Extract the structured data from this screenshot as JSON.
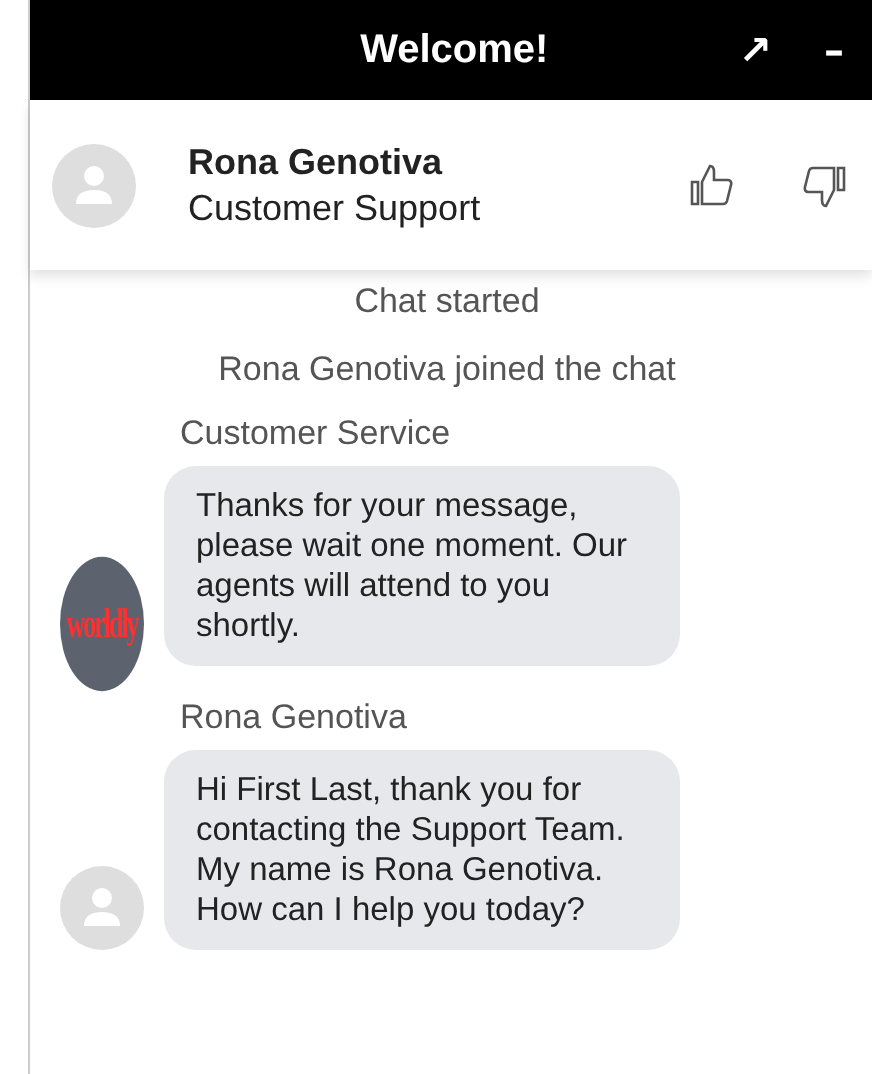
{
  "window": {
    "title": "Welcome!",
    "expand_icon": "↗",
    "minimize_icon": "–"
  },
  "agent": {
    "name": "Rona Genotiva",
    "role": "Customer Support"
  },
  "messages": [
    {
      "kind": "system",
      "text": "Chat started"
    },
    {
      "kind": "system",
      "text": "Rona Genotiva joined the chat"
    },
    {
      "kind": "message",
      "sender": "Customer Service",
      "avatar": {
        "kind": "logo",
        "text": "worldly"
      },
      "text": "Thanks for your message, please wait one moment. Our agents will attend to you shortly."
    },
    {
      "kind": "message",
      "sender": "Rona Genotiva",
      "avatar": {
        "kind": "person"
      },
      "text": "Hi First Last, thank you for contacting the Support Team. My name is Rona Genotiva. How can I help you today?"
    }
  ]
}
